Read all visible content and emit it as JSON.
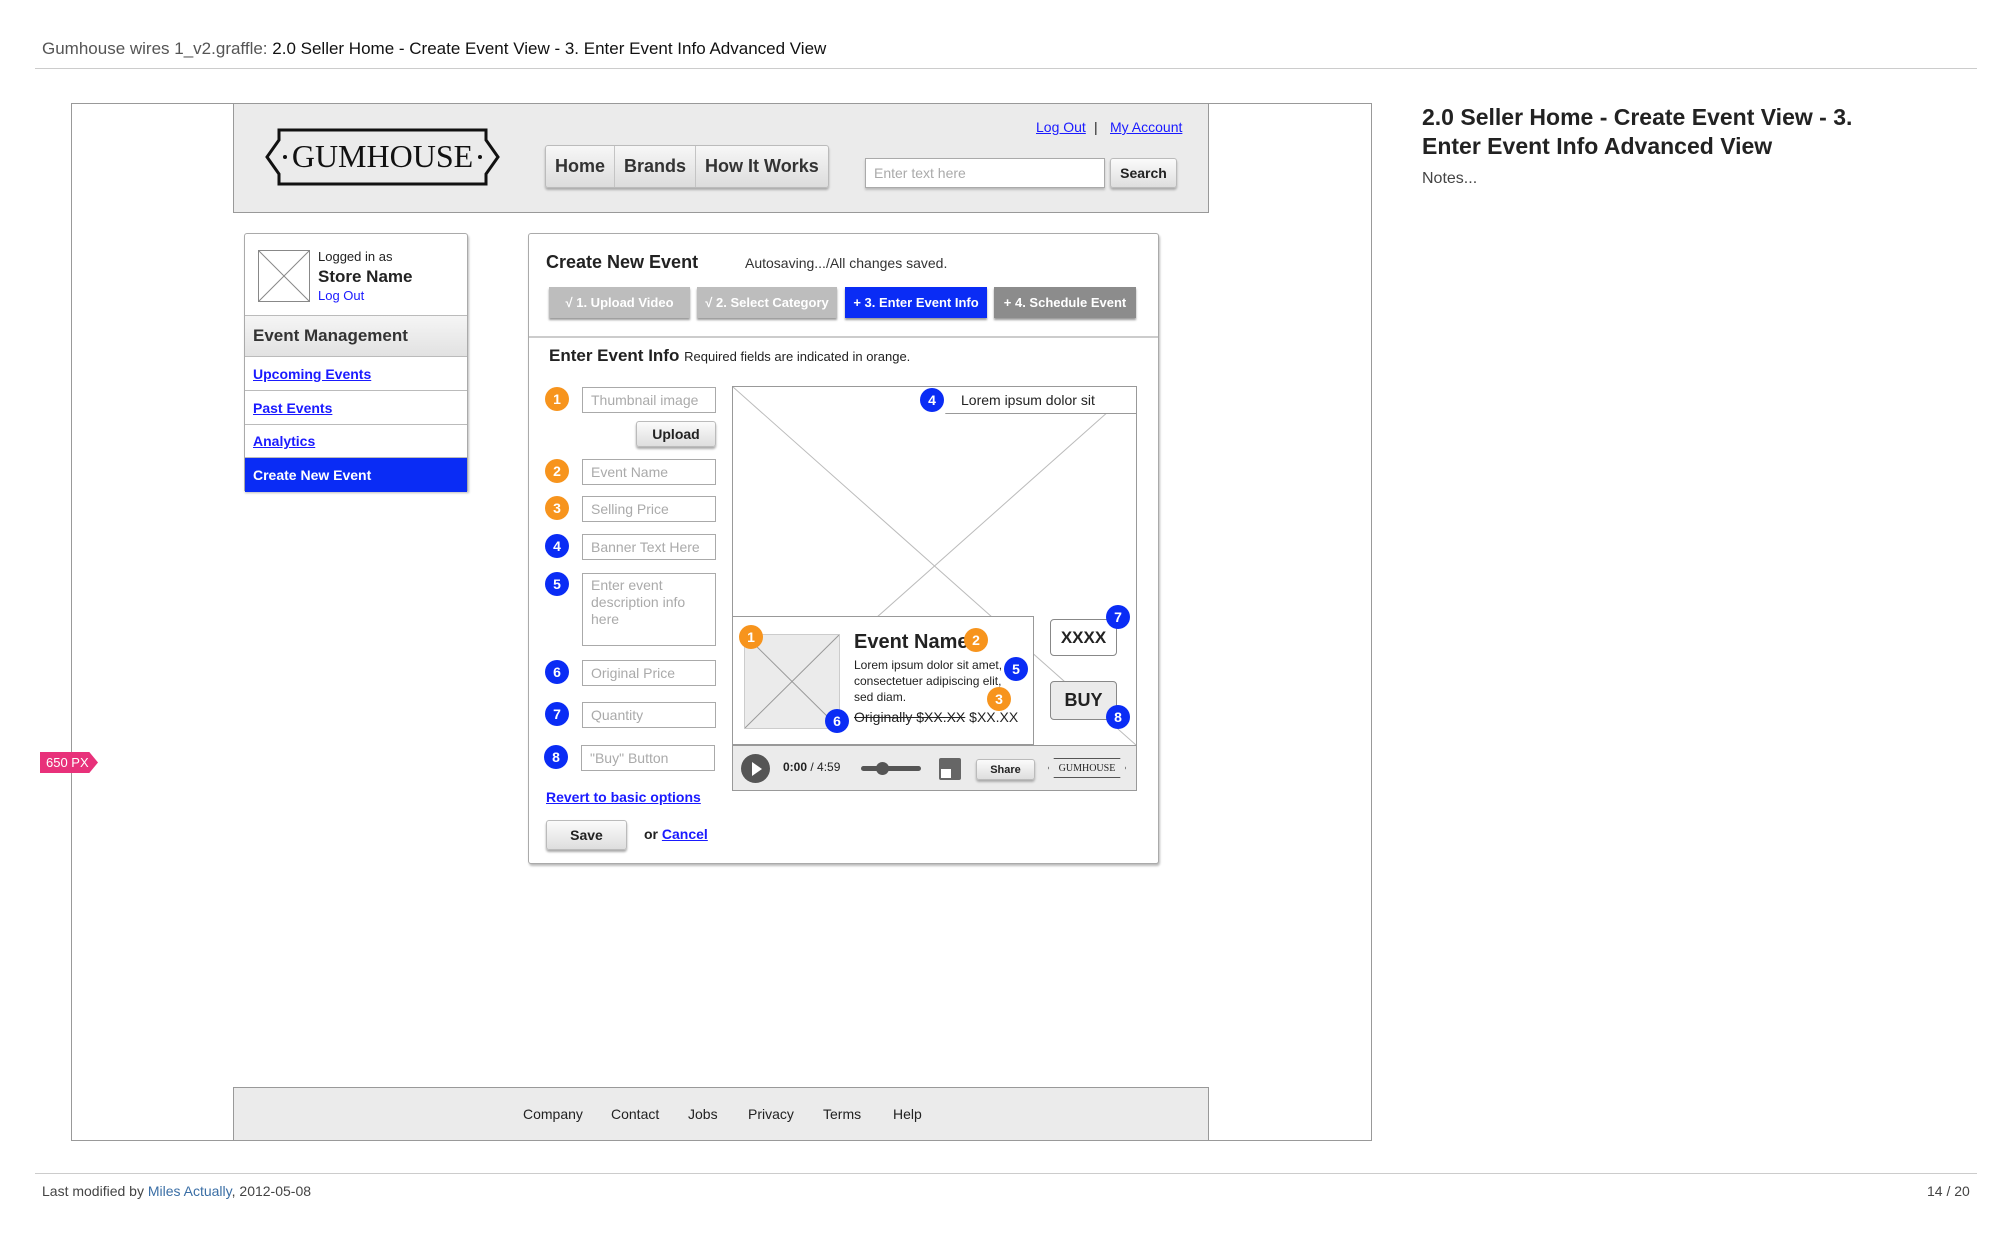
{
  "doc": {
    "file": "Gumhouse wires 1_v2.graffle:",
    "title": "2.0 Seller Home - Create Event View - 3. Enter Event Info Advanced View",
    "notes": "Notes...",
    "modified_prefix": "Last modified by ",
    "author": "Miles Actually",
    "date": ", 2012-05-08",
    "page": "14 / 20",
    "px_tag": "650 PX"
  },
  "header": {
    "logo": "GUMHOUSE",
    "nav": [
      "Home",
      "Brands",
      "How It Works"
    ],
    "logout": "Log Out",
    "sep": "|",
    "account": "My Account",
    "search_placeholder": "Enter text here",
    "search_btn": "Search"
  },
  "sidebar": {
    "logged_in": "Logged in as",
    "store": "Store Name",
    "logout": "Log Out",
    "section": "Event Management",
    "items": [
      "Upcoming Events",
      "Past Events",
      "Analytics",
      "Create New Event"
    ]
  },
  "panel": {
    "title": "Create New Event",
    "autosave": "Autosaving.../All changes saved.",
    "steps": [
      "√ 1. Upload Video",
      "√ 2. Select Category",
      "+ 3. Enter Event Info",
      "+ 4. Schedule Event"
    ],
    "section": "Enter Event Info",
    "required": "Required fields are indicated in orange.",
    "fields": {
      "thumb": "Thumbnail image",
      "upload": "Upload",
      "name": "Event Name",
      "price": "Selling Price",
      "banner": "Banner Text Here",
      "desc": "Enter event description info here",
      "orig": "Original Price",
      "qty": "Quantity",
      "buy": "\"Buy\" Button"
    },
    "revert": "Revert to basic options",
    "save": "Save",
    "or": "or",
    "cancel": "Cancel",
    "nums": [
      "1",
      "2",
      "3",
      "4",
      "5",
      "6",
      "7",
      "8"
    ]
  },
  "preview": {
    "banner": "Lorem ipsum dolor sit",
    "event_name": "Event Name",
    "desc": "Lorem ipsum dolor sit amet, consectetuer adipiscing elit, sed diam.",
    "orig": "Originally $XX.XX",
    "price": "$XX.XX",
    "qty": "XXXX",
    "buy": "BUY",
    "time": "0:00",
    "duration": "/ 4:59",
    "share": "Share",
    "logo": "GUMHOUSE",
    "volume": 0.35
  },
  "footer": {
    "links": [
      "Company",
      "Contact",
      "Jobs",
      "Privacy",
      "Terms",
      "Help"
    ]
  },
  "colors": {
    "accent": "#0a2cf5",
    "orange": "#f7941d",
    "tag": "#e8317a"
  }
}
